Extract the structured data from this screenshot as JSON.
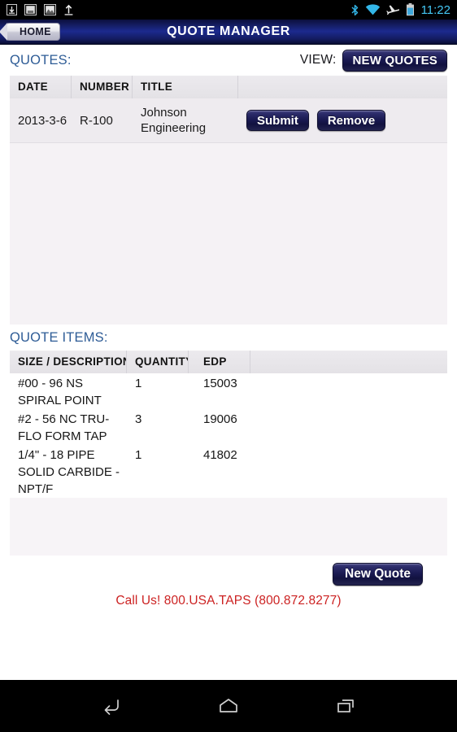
{
  "status_bar": {
    "icons_left": [
      "download-icon",
      "screenshot-icon",
      "gallery-icon",
      "upload-icon"
    ],
    "icons_right": [
      "bluetooth-icon",
      "wifi-icon",
      "airplane-mode-icon",
      "battery-icon"
    ],
    "time": "11:22",
    "time_color": "#44c8f5"
  },
  "title_bar": {
    "home_label": "HOME",
    "title": "QUOTE MANAGER",
    "bg_color": "#1c2a8e"
  },
  "quotes_section": {
    "label": "QUOTES:",
    "label_color": "#2e5c96",
    "view_label": "VIEW:",
    "view_button": "NEW QUOTES",
    "columns": [
      "DATE",
      "NUMBER",
      "TITLE",
      ""
    ],
    "rows": [
      {
        "date": "2013-3-6",
        "number": "R-100",
        "title": "Johnson Engineering",
        "submit_label": "Submit",
        "remove_label": "Remove"
      }
    ]
  },
  "items_section": {
    "label": "QUOTE ITEMS:",
    "columns": [
      "SIZE / DESCRIPTION",
      "QUANTITY",
      "EDP",
      ""
    ],
    "rows": [
      {
        "description": "#00 - 96 NS SPIRAL POINT",
        "quantity": "1",
        "edp": "15003"
      },
      {
        "description": "#2 - 56 NC TRU-FLO FORM TAP",
        "quantity": "3",
        "edp": "19006"
      },
      {
        "description": "1/4\" - 18 PIPE SOLID CARBIDE - NPT/F",
        "quantity": "1",
        "edp": "41802"
      }
    ]
  },
  "footer": {
    "new_quote_button": "New Quote",
    "call_us": "Call Us!  800.USA.TAPS  (800.872.8277)",
    "call_us_color": "#cc2222"
  },
  "nav_bar": {
    "keys": [
      "back-icon",
      "home-icon",
      "recents-icon"
    ]
  }
}
